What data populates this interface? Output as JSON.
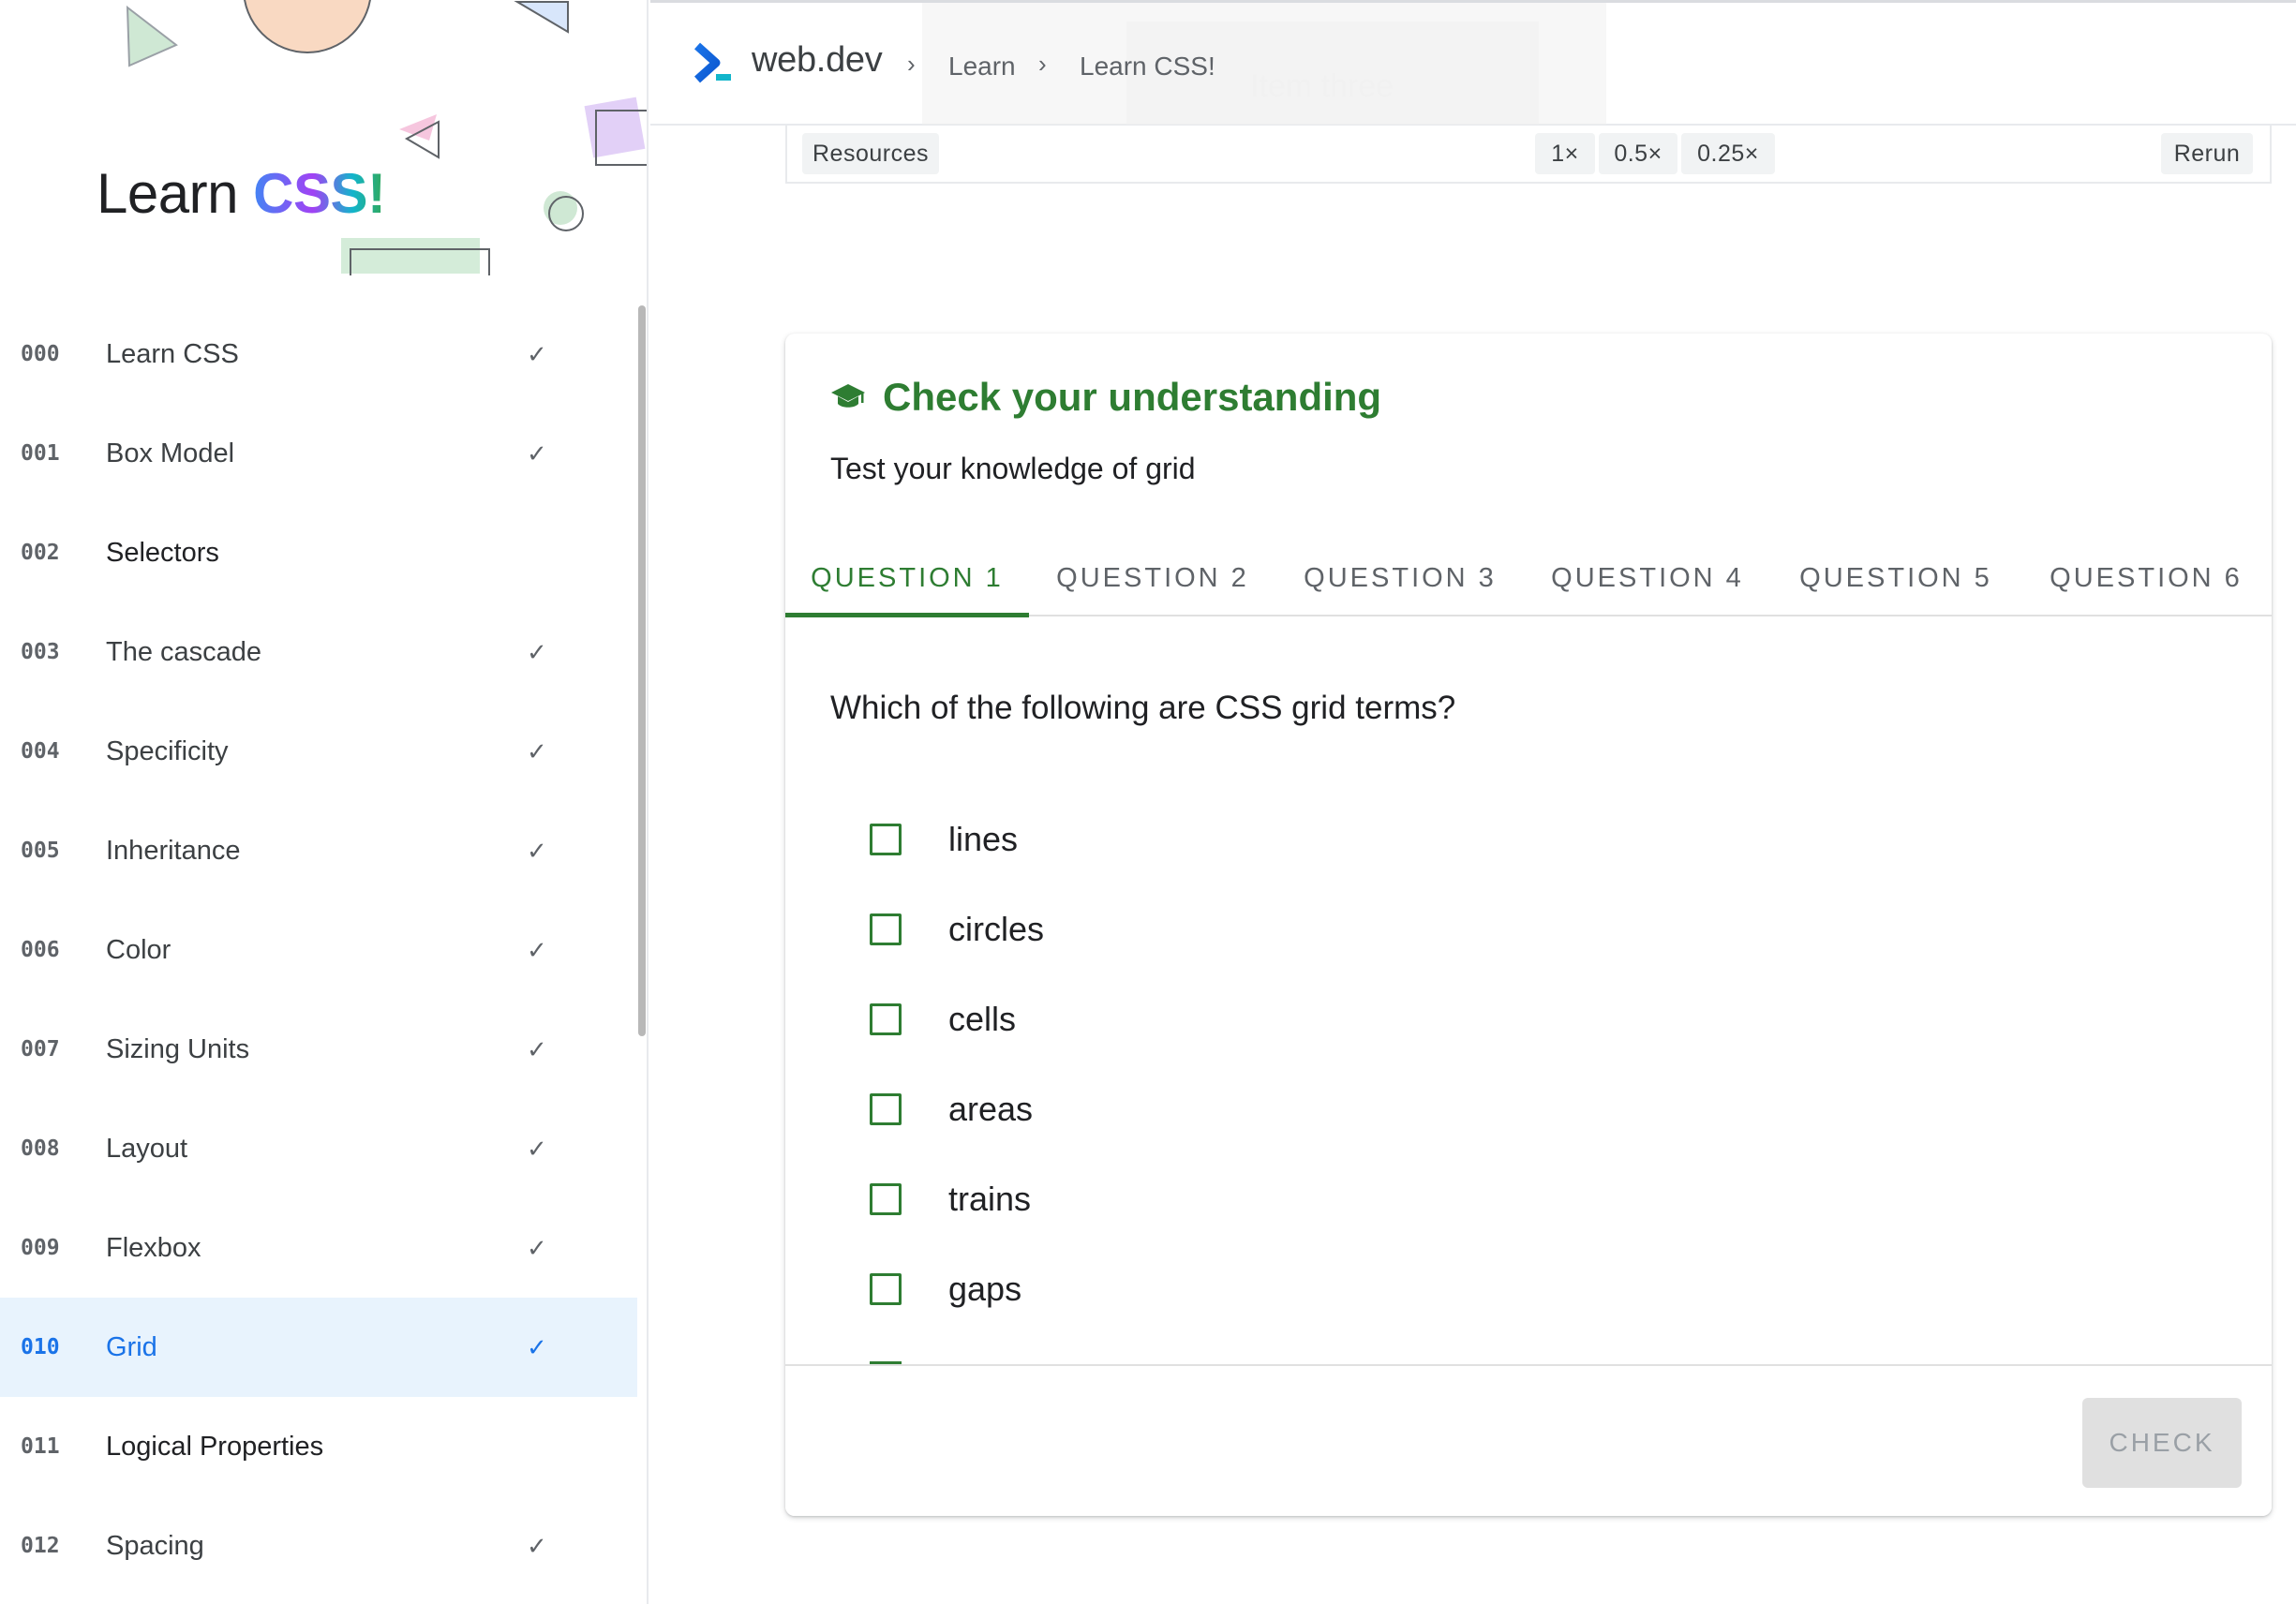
{
  "sidebar": {
    "hero_title_plain": "Learn ",
    "hero_title_accent": "CSS!",
    "items": [
      {
        "num": "000",
        "label": "Learn CSS",
        "done": true,
        "bold": false
      },
      {
        "num": "001",
        "label": "Box Model",
        "done": true,
        "bold": false
      },
      {
        "num": "002",
        "label": "Selectors",
        "done": false,
        "bold": true
      },
      {
        "num": "003",
        "label": "The cascade",
        "done": true,
        "bold": false
      },
      {
        "num": "004",
        "label": "Specificity",
        "done": true,
        "bold": false
      },
      {
        "num": "005",
        "label": "Inheritance",
        "done": true,
        "bold": false
      },
      {
        "num": "006",
        "label": "Color",
        "done": true,
        "bold": false
      },
      {
        "num": "007",
        "label": "Sizing Units",
        "done": true,
        "bold": false
      },
      {
        "num": "008",
        "label": "Layout",
        "done": true,
        "bold": false
      },
      {
        "num": "009",
        "label": "Flexbox",
        "done": true,
        "bold": false
      },
      {
        "num": "010",
        "label": "Grid",
        "done": true,
        "bold": false,
        "active": true
      },
      {
        "num": "011",
        "label": "Logical Properties",
        "done": false,
        "bold": true
      },
      {
        "num": "012",
        "label": "Spacing",
        "done": true,
        "bold": false
      }
    ],
    "check_glyph": "✓"
  },
  "topbar": {
    "logo_text": "web.dev",
    "breadcrumbs": [
      "Learn",
      "Learn CSS!"
    ],
    "separator": "›",
    "ghost_text": "Item three"
  },
  "demo_toolbar": {
    "resources_label": "Resources",
    "speeds": [
      "1×",
      "0.5×",
      "0.25×"
    ],
    "rerun_label": "Rerun"
  },
  "quiz": {
    "title": "Check your understanding",
    "subtitle": "Test your knowledge of grid",
    "tabs": [
      "QUESTION 1",
      "QUESTION 2",
      "QUESTION 3",
      "QUESTION 4",
      "QUESTION 5",
      "QUESTION 6"
    ],
    "active_tab": 0,
    "question": "Which of the following are CSS grid terms?",
    "options": [
      "lines",
      "circles",
      "cells",
      "areas",
      "trains",
      "gaps"
    ],
    "check_label": "CHECK"
  },
  "colors": {
    "accent_green": "#2e7d32",
    "active_blue": "#1a73e8",
    "active_bg": "#e8f3fd"
  },
  "icons": {
    "logo": "webdev-chevron-icon",
    "quiz": "graduation-cap-icon",
    "done": "checkmark-icon"
  }
}
